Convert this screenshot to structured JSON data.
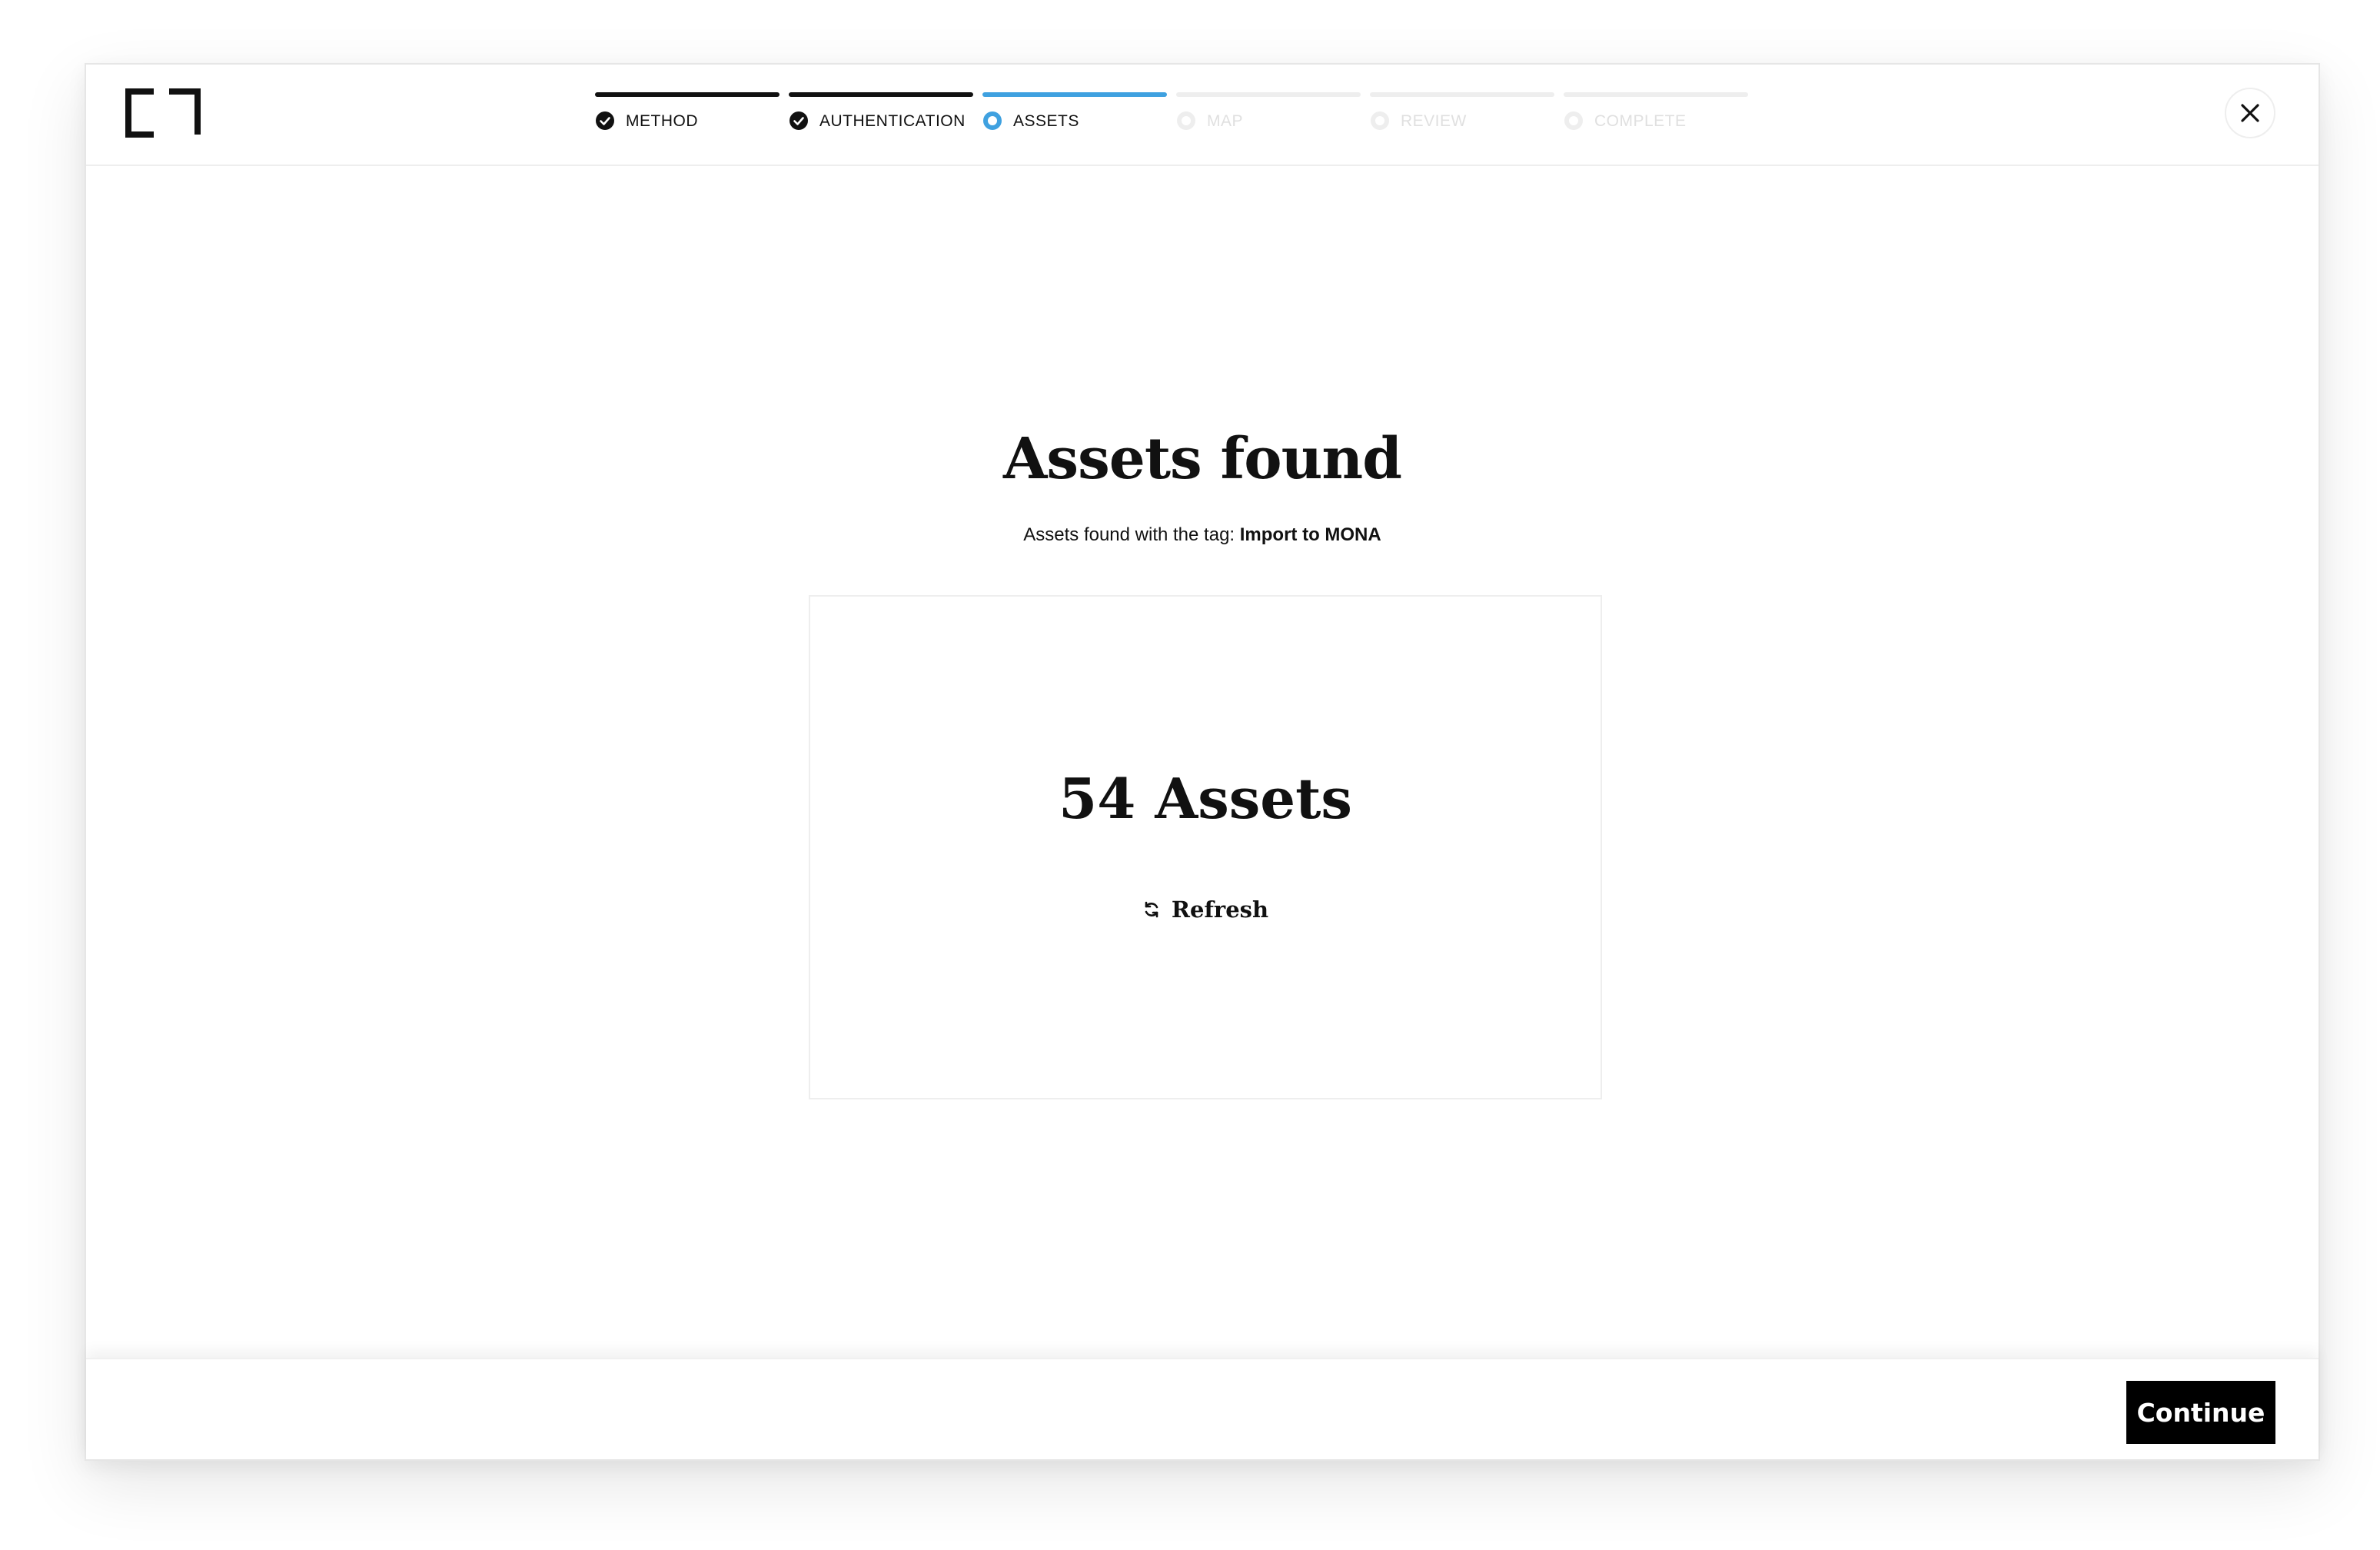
{
  "header": {
    "logo_icon": "bracket-logo-icon",
    "close_icon": "close-icon"
  },
  "steps": [
    {
      "label": "METHOD",
      "state": "done",
      "icon": "check-circle-icon"
    },
    {
      "label": "AUTHENTICATION",
      "state": "done",
      "icon": "check-circle-icon"
    },
    {
      "label": "ASSETS",
      "state": "active",
      "icon": "ring-circle-icon"
    },
    {
      "label": "MAP",
      "state": "pending",
      "icon": "ring-circle-icon"
    },
    {
      "label": "REVIEW",
      "state": "pending",
      "icon": "ring-circle-icon"
    },
    {
      "label": "COMPLETE",
      "state": "pending",
      "icon": "ring-circle-icon"
    }
  ],
  "main": {
    "title": "Assets found",
    "subtitle_prefix": "Assets found with the tag: ",
    "tag": "Import to MONA",
    "count_label": "54 Assets",
    "refresh_label": "Refresh",
    "refresh_icon": "refresh-icon"
  },
  "footer": {
    "continue_label": "Continue"
  },
  "colors": {
    "active_step": "#3fa1e0",
    "done_step": "#111111",
    "pending_step": "#eeeeee",
    "primary_button": "#000000"
  }
}
